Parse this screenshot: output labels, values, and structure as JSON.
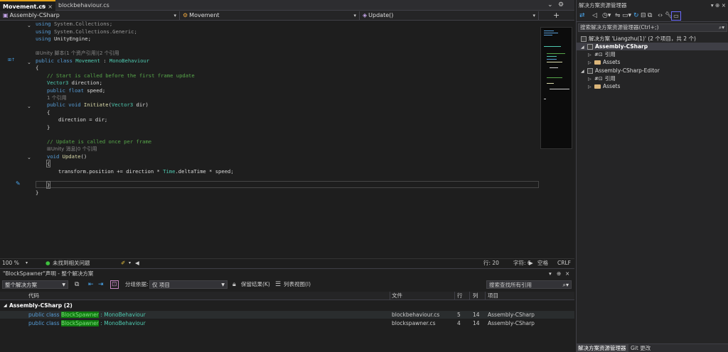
{
  "tabs": [
    {
      "label": "Movement.cs",
      "icons": "⊕ ×"
    },
    {
      "label": "blockbehaviour.cs"
    }
  ],
  "navbar": {
    "project": "Assembly-CSharp",
    "class": "Movement",
    "method": "Update()"
  },
  "code": {
    "l1_kw": "using",
    "l1_rest": " System.Collections;",
    "l2_kw": "using",
    "l2_rest": " System.Collections.Generic;",
    "l3_kw": "using",
    "l3_rest": " UnityEngine;",
    "codelens1": "⊞Unity 脚本(1 个资产引用)|2 个引用",
    "l5_public": "public",
    "l5_class": " class ",
    "l5_name": "Movement",
    "l5_colon": " : ",
    "l5_base": "MonoBehaviour",
    "l6": "{",
    "l7_comment": "// Start is called before the first frame update",
    "l8_type": "Vector3",
    "l8_rest": " direction;",
    "l9_public": "public",
    "l9_float": " float",
    "l9_rest": " speed;",
    "codelens2": "1 个引用",
    "l10_public": "public",
    "l10_void": " void",
    "l10_fn": " Initiate",
    "l10_open": "(",
    "l10_type": "Vector3",
    "l10_rest": " dir)",
    "l11": "{",
    "l12": "direction = dir;",
    "l13": "}",
    "l15_comment": "// Update is called once per frame",
    "codelens3": "⊞Unity 消息|0 个引用",
    "l16_void": "void",
    "l16_fn": " Update",
    "l16_rest": "()",
    "l17": "{",
    "l18_a": "transform.position += direction * ",
    "l18_type": "Time",
    "l18_b": ".deltaTime * speed;",
    "l20": "}",
    "l21": "}"
  },
  "editor_status": {
    "zoom": "100 %",
    "issues": "未找到相关问题",
    "line": "行: 20",
    "char": "字符: 6",
    "spaces": "空格",
    "eol": "CRLF"
  },
  "find_refs": {
    "title": "\"BlockSpawner\"声明 - 整个解决方案",
    "scope": "整个解决方案",
    "group_by_label": "分组依据:",
    "group_by_value": "仅 项目",
    "keep_results": "保留结果(K)",
    "list_view": "列表视图(I)",
    "search_placeholder": "搜索查找所有引用",
    "columns": {
      "code": "代码",
      "file": "文件",
      "line": "行",
      "col": "列",
      "project": "项目"
    },
    "group": "Assembly-CSharp  (2)",
    "rows": [
      {
        "pre": "public class ",
        "hit": "BlockSpawner",
        "post": " : MonoBehaviour",
        "file": "blockbehaviour.cs",
        "line": "5",
        "col": "14",
        "project": "Assembly-CSharp"
      },
      {
        "pre": "public class ",
        "hit": "BlockSpawner",
        "post": " : MonoBehaviour",
        "file": "blockspawner.cs",
        "line": "4",
        "col": "14",
        "project": "Assembly-CSharp"
      }
    ]
  },
  "solution_explorer": {
    "title": "解决方案资源管理器",
    "search_placeholder": "搜索解决方案资源管理器(Ctrl+;)",
    "solution": "解决方案 'Liangzhu(1)' (2 个项目，共 2 个)",
    "proj1": "Assembly-CSharp",
    "proj1_refs": "引用",
    "proj1_assets": "Assets",
    "proj2": "Assembly-CSharp-Editor",
    "proj2_refs": "引用",
    "proj2_assets": "Assets",
    "bottom_tabs": [
      "解决方案资源管理器",
      "Git 更改"
    ]
  },
  "colors": {
    "accent": "#e3a21a",
    "keyword": "#569cd6",
    "type": "#4ec9b0",
    "comment": "#57a64a",
    "highlight": "#0e7a0e"
  }
}
